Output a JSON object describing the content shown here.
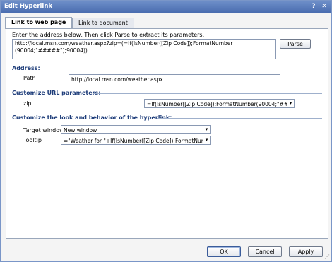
{
  "window": {
    "title": "Edit Hyperlink",
    "help_icon": "?",
    "close_icon": "✕"
  },
  "tabs": [
    {
      "label": "Link to web page",
      "active": true
    },
    {
      "label": "Link to document",
      "active": false
    }
  ],
  "instruction": "Enter the address below, Then click Parse to extract its parameters.",
  "address_value": "http://local.msn.com/weather.aspx?zip=(=If(IsNumber([Zip Code]);FormatNumber\n(90004;\"#####\");90004))",
  "parse_label": "Parse",
  "address_section": {
    "heading": "Address:",
    "path_label": "Path",
    "path_value": "http://local.msn.com/weather.aspx"
  },
  "url_params_section": {
    "heading": "Customize URL parameters:",
    "param_label": "zip",
    "param_value": "=If(IsNumber([Zip Code]);FormatNumber(90004;\"#####\""
  },
  "look_section": {
    "heading": "Customize the look and behavior of the hyperlink:",
    "target_label": "Target window",
    "target_value": "New window",
    "tooltip_label": "Tooltip",
    "tooltip_value": "=\"Weather for \"+If(IsNumber([Zip Code]);FormatNumber(9"
  },
  "buttons": {
    "ok": "OK",
    "cancel": "Cancel",
    "apply": "Apply"
  },
  "colors": {
    "title_bar": "#4a6db0",
    "section_heading": "#1e3d7a"
  }
}
